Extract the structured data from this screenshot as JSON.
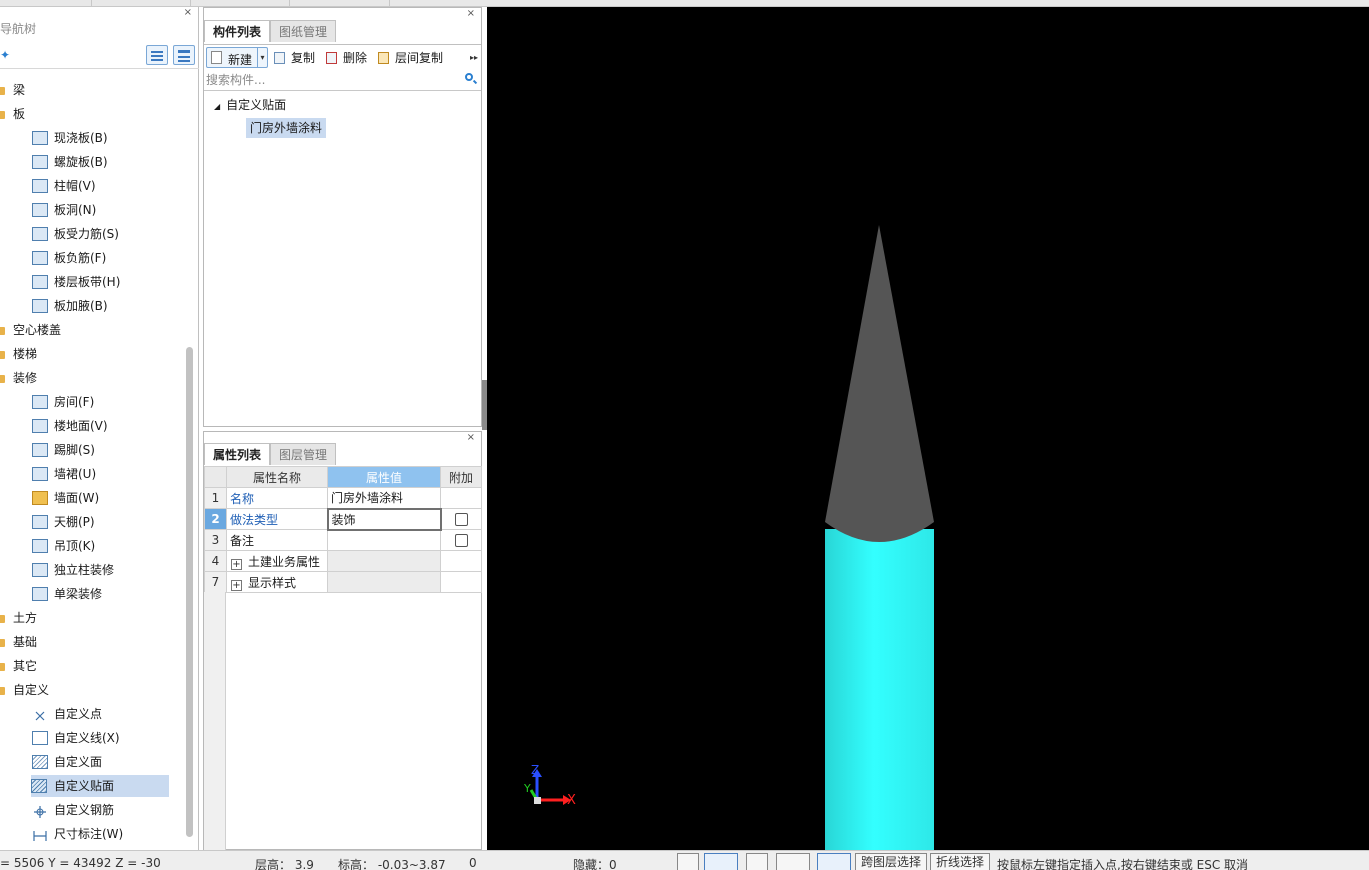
{
  "nav": {
    "title": "导航树",
    "close": "×",
    "star": "✦",
    "categories_top": [
      "梁",
      "板"
    ],
    "board_items": [
      "现浇板(B)",
      "螺旋板(B)",
      "柱帽(V)",
      "板洞(N)",
      "板受力筋(S)",
      "板负筋(F)",
      "楼层板带(H)",
      "板加腋(B)"
    ],
    "categories_mid": [
      "空心楼盖",
      "楼梯",
      "装修"
    ],
    "decor_items": [
      "房间(F)",
      "楼地面(V)",
      "踢脚(S)",
      "墙裙(U)",
      "墙面(W)",
      "天棚(P)",
      "吊顶(K)",
      "独立柱装修",
      "单梁装修"
    ],
    "categories_bottom": [
      "土方",
      "基础",
      "其它",
      "自定义"
    ],
    "custom_items": [
      "自定义点",
      "自定义线(X)",
      "自定义面",
      "自定义贴面",
      "自定义钢筋",
      "尺寸标注(W)"
    ],
    "selected_item": "自定义贴面"
  },
  "component_panel": {
    "close": "×",
    "tab_active": "构件列表",
    "tab_inactive": "图纸管理",
    "toolbar": {
      "new": "新建",
      "dropdown": "▾",
      "copy": "复制",
      "delete": "删除",
      "floor_copy": "层间复制",
      "more": "▸▸"
    },
    "search_placeholder": "搜索构件...",
    "tree_group": "自定义贴面",
    "tree_group_toggle": "◢",
    "tree_leaf": "门房外墙涂料"
  },
  "properties_panel": {
    "close": "×",
    "tab_active": "属性列表",
    "tab_inactive": "图层管理",
    "headers": [
      "",
      "属性名称",
      "属性值",
      "附加"
    ],
    "rows": [
      {
        "num": "1",
        "name": "名称",
        "value": "门房外墙涂料"
      },
      {
        "num": "2",
        "name": "做法类型",
        "value": "装饰"
      },
      {
        "num": "3",
        "name": "备注",
        "value": ""
      },
      {
        "num": "4",
        "name": "土建业务属性",
        "value": "",
        "expand": "+"
      },
      {
        "num": "7",
        "name": "显示样式",
        "value": "",
        "expand": "+"
      }
    ]
  },
  "viewport": {
    "background": "#000000",
    "cylinder_color": "#33ffff",
    "cone_color": "#555555",
    "axis_labels": {
      "x": "X",
      "y": "Y",
      "z": "Z"
    },
    "axis_colors": {
      "x": "#ff2020",
      "y": "#20cc20",
      "z": "#2a4fff"
    }
  },
  "status": {
    "coords": "= 5506 Y = 43492 Z = -30",
    "floor_height": "层高： 3.9",
    "elevation": "标高： -0.03~3.87",
    "zero": "0",
    "hidden": "隐藏：0",
    "cross_layer_select": "跨图层选择",
    "polyline_select": "折线选择",
    "hint": "按鼠标左键指定插入点,按右键结束或 ESC 取消"
  }
}
